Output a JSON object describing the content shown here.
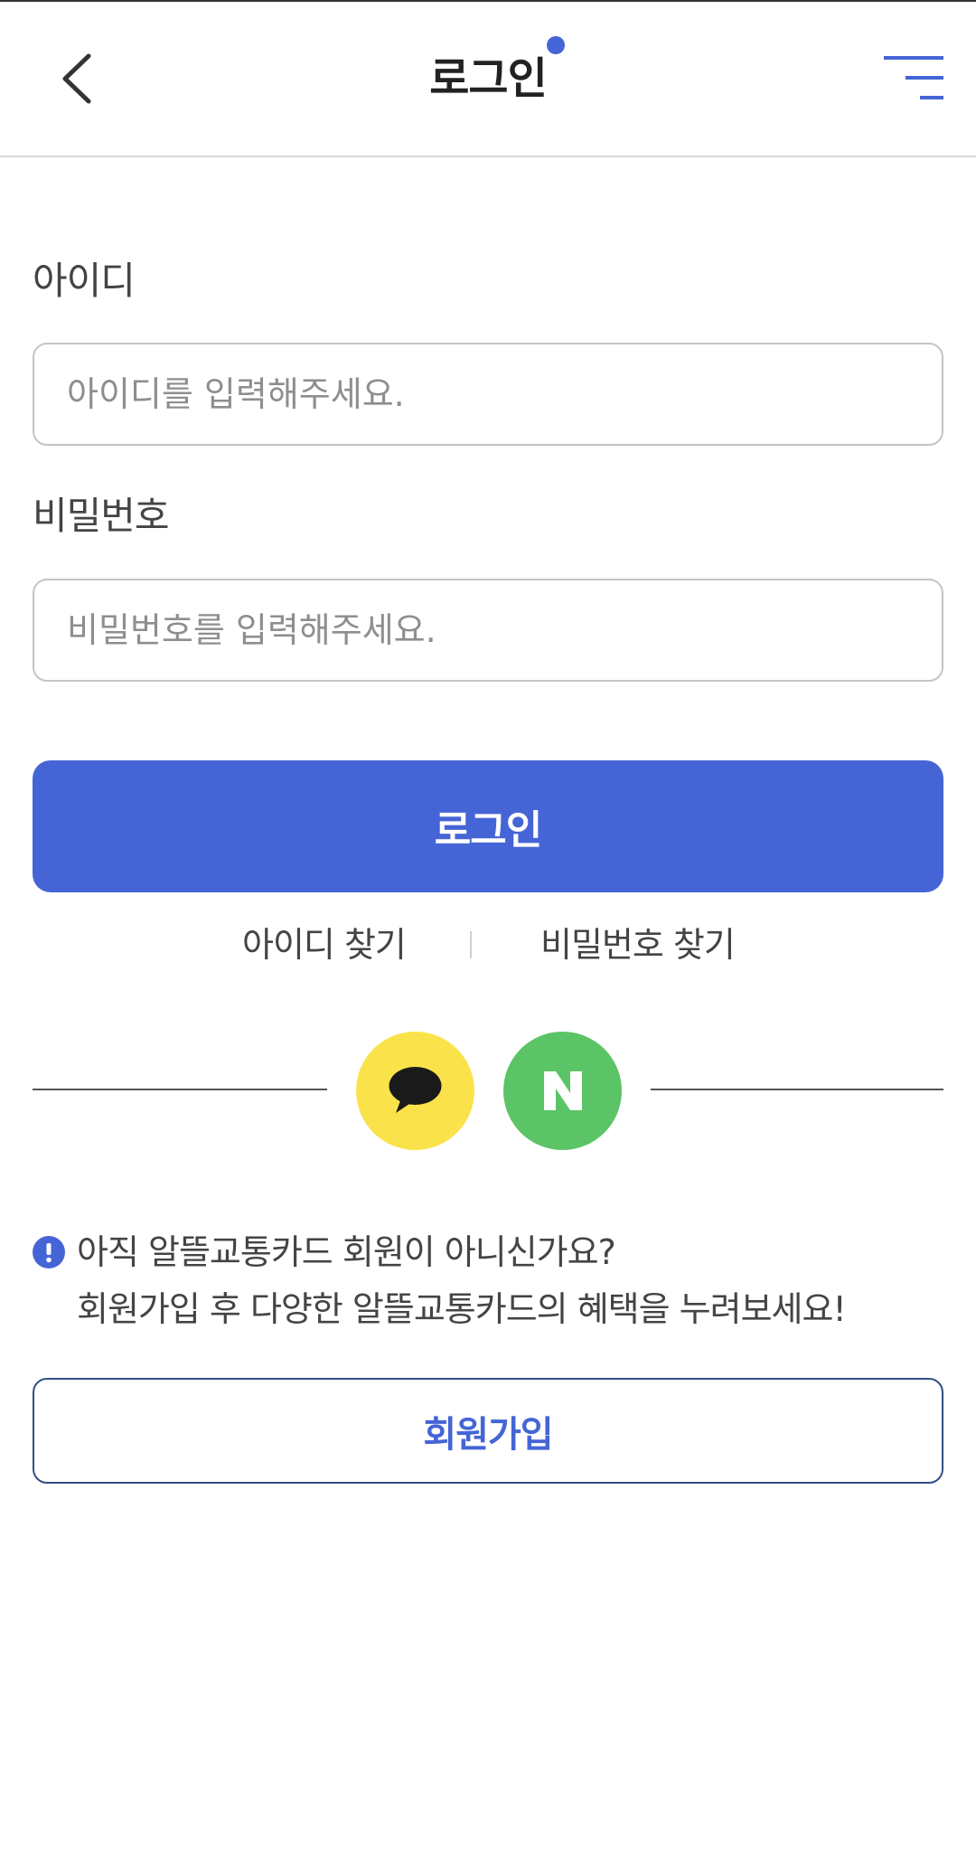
{
  "header": {
    "title": "로그인",
    "back_icon": "chevron-left-icon",
    "menu_icon": "hamburger-menu-icon"
  },
  "form": {
    "id_label": "아이디",
    "id_placeholder": "아이디를 입력해주세요.",
    "id_value": "",
    "password_label": "비밀번호",
    "password_placeholder": "비밀번호를 입력해주세요.",
    "password_value": "",
    "login_button_label": "로그인"
  },
  "find_links": {
    "find_id_label": "아이디 찾기",
    "find_password_label": "비밀번호 찾기"
  },
  "social_login": {
    "kakao_icon": "kakao-speech-bubble-icon",
    "naver_icon": "naver-n-icon"
  },
  "notice": {
    "icon": "exclamation-circle-icon",
    "line1": "아직 알뜰교통카드 회원이 아니신가요?",
    "line2": "회원가입 후 다양한 알뜰교통카드의 혜택을 누려보세요!"
  },
  "signup": {
    "button_label": "회원가입"
  },
  "colors": {
    "primary": "#4565d6",
    "kakao": "#fae34a",
    "naver": "#5bc466",
    "signup_border": "#2f4f87"
  }
}
